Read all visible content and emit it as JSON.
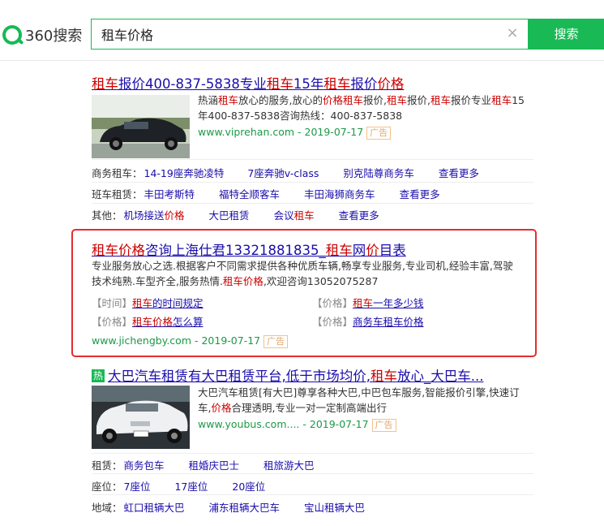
{
  "header": {
    "logo_text": "360搜索",
    "query": "租车价格",
    "search_label": "搜索",
    "clear_icon": "×"
  },
  "results": [
    {
      "title_parts": [
        "租车",
        "报价400-837-5838专业",
        "租车",
        "15年",
        "租车",
        "报价",
        "价格"
      ],
      "desc": [
        "热涵",
        "租车",
        "放心的服务,放心的",
        "价格",
        "租车",
        "报价,",
        "租车",
        "报价,",
        "租车",
        "报价专业",
        "租车",
        "15年400-837-5838咨询热线：400-837-5838"
      ],
      "url": "www.viprehan.com",
      "date": "2019-07-17",
      "ad": "广告",
      "rows": [
        {
          "label": "商务租车：",
          "links": [
            "14-19座奔驰凌特",
            "7座奔驰v-class",
            "别克陆尊商务车",
            "查看更多"
          ]
        },
        {
          "label": "班车租赁：",
          "links": [
            "丰田考斯特",
            "福特全顺客车",
            "丰田海狮商务车",
            "查看更多"
          ]
        },
        {
          "label": "其他：",
          "links": [
            "机场接送价格",
            "大巴租赁",
            "会议租车",
            "查看更多"
          ]
        }
      ]
    },
    {
      "title_parts": [
        "租车价格",
        "咨询上海仕君13321881835_",
        "租车",
        "网",
        "价",
        "目表"
      ],
      "desc_line1": "专业服务放心之选.根据客户不同需求提供各种优质车辆,畅享专业服务,专业司机,经验丰富,驾驶",
      "desc_line2_a": "技术纯熟.车型齐全,服务热情.",
      "desc_line2_hl": "租车价格",
      "desc_line2_b": ",欢迎咨询13052075287",
      "subs": [
        {
          "tag": "【时间】",
          "hl": "租车",
          "rest": "的时间规定"
        },
        {
          "tag": "【价格】",
          "hl": "租车",
          "rest": "一年多少钱"
        },
        {
          "tag": "【价格】",
          "hl": "租车价格",
          "rest": "怎么算"
        },
        {
          "tag": "【价格】",
          "hl": "",
          "rest": "商务车租车价格"
        }
      ],
      "url": "www.jichengby.com",
      "date": "2019-07-17",
      "ad": "广告"
    },
    {
      "hot_badge": "热",
      "title_a": "大巴汽车租赁有大巴租赁平台,低于市场均价,",
      "title_hl": "租车",
      "title_b": "放心_大巴车...",
      "desc_a": "大巴汽车租赁[有大巴]尊享各种大巴,中巴包车服务,智能报价引擎,快速订",
      "desc_b1": "车,",
      "desc_hl": "价格",
      "desc_b2": "合理透明,专业一对一定制高端出行",
      "url": "www.youbus.com....",
      "date": "2019-07-17",
      "ad": "广告",
      "rows": [
        {
          "label": "租赁：",
          "links": [
            "商务包车",
            "租婚庆巴士",
            "租旅游大巴"
          ]
        },
        {
          "label": "座位：",
          "links": [
            "7座位",
            "17座位",
            "20座位"
          ]
        },
        {
          "label": "地域：",
          "links": [
            "虹口租辆大巴",
            "浦东租辆大巴车",
            "宝山租辆大巴"
          ]
        }
      ]
    }
  ],
  "colors": {
    "brand_green": "#19b955",
    "link": "#1a0dab",
    "highlight": "#cc0000",
    "box": "#e52d2d"
  }
}
